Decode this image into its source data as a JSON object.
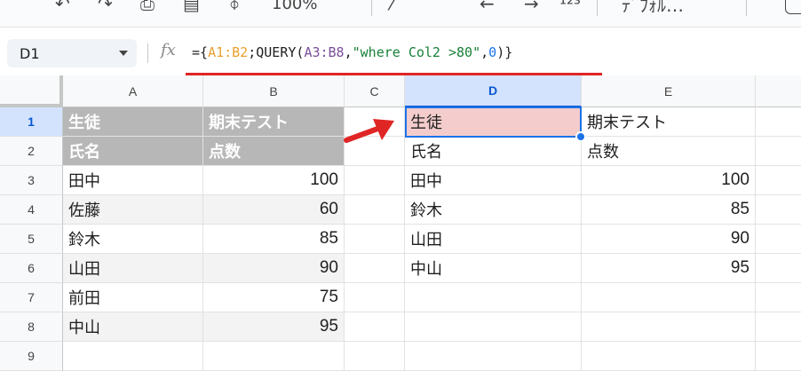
{
  "toolbar": {
    "zoom": "100%",
    "zoom_label_partial": "100%"
  },
  "formula_bar": {
    "cell_ref": "D1",
    "fx": "fx",
    "formula_parts": {
      "p1": "={",
      "p2": "A1:B2",
      "p3": ";QUERY(",
      "p4": "A3:B8",
      "p5": ",",
      "p6": "\"where Col2 >80\"",
      "p7": ",",
      "p8": "0",
      "p9": ")}"
    }
  },
  "columns": [
    "A",
    "B",
    "C",
    "D",
    "E"
  ],
  "rows": [
    "1",
    "2",
    "3",
    "4",
    "5",
    "6",
    "7",
    "8",
    "9"
  ],
  "source_table": {
    "header_row1": [
      "生徒",
      "期末テスト"
    ],
    "header_row2": [
      "氏名",
      "点数"
    ],
    "names": [
      "田中",
      "佐藤",
      "鈴木",
      "山田",
      "前田",
      "中山"
    ],
    "scores": [
      "100",
      "60",
      "85",
      "90",
      "75",
      "95"
    ]
  },
  "result_table": {
    "header_row1": [
      "生徒",
      "期末テスト"
    ],
    "header_row2": [
      "氏名",
      "点数"
    ],
    "names": [
      "田中",
      "鈴木",
      "山田",
      "中山"
    ],
    "scores": [
      "100",
      "85",
      "90",
      "95"
    ]
  },
  "colors": {
    "highlight_red": "#e02525",
    "selection_blue": "#1a73e8",
    "header_gray": "#b7b7b7",
    "pink_fill": "#f4cccc"
  }
}
